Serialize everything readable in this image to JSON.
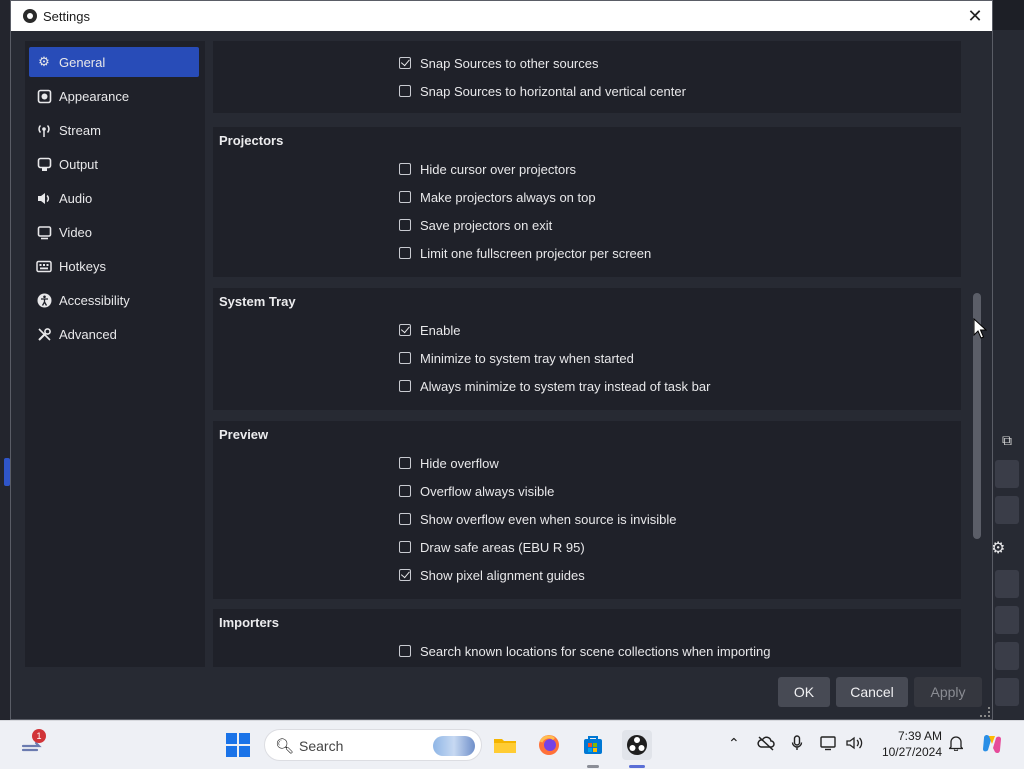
{
  "window": {
    "title": "Settings"
  },
  "sidebar": {
    "items": [
      {
        "label": "General",
        "icon": "gear-icon",
        "active": true
      },
      {
        "label": "Appearance",
        "icon": "appearance-icon",
        "active": false
      },
      {
        "label": "Stream",
        "icon": "broadcast-icon",
        "active": false
      },
      {
        "label": "Output",
        "icon": "output-icon",
        "active": false
      },
      {
        "label": "Audio",
        "icon": "speaker-icon",
        "active": false
      },
      {
        "label": "Video",
        "icon": "monitor-icon",
        "active": false
      },
      {
        "label": "Hotkeys",
        "icon": "keyboard-icon",
        "active": false
      },
      {
        "label": "Accessibility",
        "icon": "accessibility-icon",
        "active": false
      },
      {
        "label": "Advanced",
        "icon": "tools-icon",
        "active": false
      }
    ]
  },
  "sections": {
    "snapping": {
      "items": [
        {
          "label": "Snap Sources to other sources",
          "checked": true
        },
        {
          "label": "Snap Sources to horizontal and vertical center",
          "checked": false
        }
      ]
    },
    "projectors": {
      "title": "Projectors",
      "items": [
        {
          "label": "Hide cursor over projectors",
          "checked": false
        },
        {
          "label": "Make projectors always on top",
          "checked": false
        },
        {
          "label": "Save projectors on exit",
          "checked": false
        },
        {
          "label": "Limit one fullscreen projector per screen",
          "checked": false
        }
      ]
    },
    "system_tray": {
      "title": "System Tray",
      "items": [
        {
          "label": "Enable",
          "checked": true
        },
        {
          "label": "Minimize to system tray when started",
          "checked": false
        },
        {
          "label": "Always minimize to system tray instead of task bar",
          "checked": false
        }
      ]
    },
    "preview": {
      "title": "Preview",
      "items": [
        {
          "label": "Hide overflow",
          "checked": false
        },
        {
          "label": "Overflow always visible",
          "checked": false
        },
        {
          "label": "Show overflow even when source is invisible",
          "checked": false
        },
        {
          "label": "Draw safe areas (EBU R 95)",
          "checked": false
        },
        {
          "label": "Show pixel alignment guides",
          "checked": true
        }
      ]
    },
    "importers": {
      "title": "Importers",
      "items": [
        {
          "label": "Search known locations for scene collections when importing",
          "checked": false
        }
      ]
    }
  },
  "buttons": {
    "ok": "OK",
    "cancel": "Cancel",
    "apply": "Apply"
  },
  "taskbar": {
    "notification_count": "1",
    "search_label": "Search",
    "time": "7:39 AM",
    "date": "10/27/2024",
    "pinned_apps": [
      "file-explorer-icon",
      "firefox-icon",
      "microsoft-store-icon",
      "obs-studio-icon"
    ]
  },
  "colors": {
    "accent": "#284cb8",
    "dialog_bg": "#272a33",
    "panel_bg": "#1f2129",
    "taskbar_bg": "#eef0f5"
  }
}
